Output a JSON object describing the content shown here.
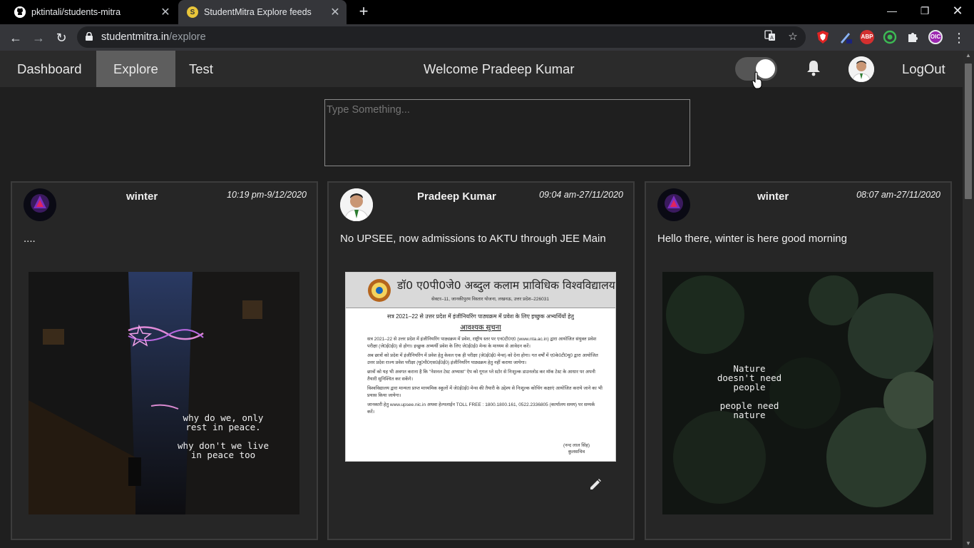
{
  "browser": {
    "tabs": [
      {
        "title": "pktintali/students-mitra",
        "icon": "github-icon",
        "active": false
      },
      {
        "title": "StudentMitra Explore feeds",
        "icon": "studentmitra-favicon",
        "active": true
      }
    ],
    "url_domain": "studentmitra.in",
    "url_path": "/explore",
    "extensions": [
      "brave-shield-icon",
      "pen-extension-icon",
      "adblock-plus-icon",
      "circle-extension-icon",
      "puzzle-extensions-icon",
      "profile-extension-icon"
    ],
    "abp_label": "ABP",
    "profile_badge": "OIC"
  },
  "nav": {
    "links": [
      "Dashboard",
      "Explore",
      "Test"
    ],
    "active": "Explore",
    "welcome": "Welcome Pradeep Kumar",
    "theme_toggle_on": true,
    "logout": "LogOut"
  },
  "composer": {
    "placeholder": "Type Something..."
  },
  "posts": [
    {
      "author": "winter",
      "time": "10:19 pm-9/12/2020",
      "text": "....",
      "image_caption": "why do we, only rest in peace. why don't we live in peace too",
      "image_caption_lines": [
        "why do we, only",
        "rest in peace.",
        "",
        "why don't we live",
        "in peace too"
      ]
    },
    {
      "author": "Pradeep Kumar",
      "time": "09:04 am-27/11/2020",
      "text": "No UPSEE, now admissions to AKTU through JEE Main",
      "image_doc": {
        "heading": "डॉ0 ए0पी0जे0 अब्दुल कलाम प्राविधिक विश्वविद्यालय",
        "subheading": "सेक्टर–11, जानकीपुरम विस्तार योजना, लखनऊ, उत्तर प्रदेश–226031",
        "intro": "सत्र 2021–22 से उत्तर प्रदेश में इंजीनियरिंग पाठ्यक्रम में प्रवेश के लिए इच्छुक अभ्यर्थियों हेतु",
        "notice_title": "आवश्यक सूचना",
        "bullets": [
          "सत्र 2021–22 से उत्तर प्रदेश में इंजीनियरिंग पाठ्यक्रम में प्रवेश, राष्ट्रीय स्तर पर एन0टी0ए0 (www.nta.ac.in) द्वारा आयोजित संयुक्त प्रवेश परीक्षा (जे0ई0ई0) से होगा। इच्छुक अभ्यर्थी प्रवेश के लिए जे0ई0ई0 मेन्स के माध्यम से आवेदन करें।",
          "अब छात्रों को प्रदेश में इंजीनियरिंग में प्रवेश हेतु केवल एक ही परीक्षा (जे0ई0ई0 मेन्स) को देना होगा। गत वर्षों में ए0के0टी0यू0 द्वारा आयोजित उत्तर प्रदेश राज्य प्रवेश परीक्षा (यू0पी0एस0ई0ई0) इंजीनियरिंग पाठ्यक्रम हेतु नहीं कराया जायेगा।",
          "छात्रों को यह भी अवगत कराना है कि \"नेशनल टेस्ट अभ्यास\" ऐप को गूगल प्ले स्टोर से निःशुल्क डाउनलोड कर मॉक टेस्ट के आधार पर अपनी तैयारी सुनिश्चित कर सकेंगे।",
          "विश्वविद्यालय द्वारा मान्यता प्राप्त माध्यमिक स्कूलों में जे0ई0ई0 मेन्स की तैयारी के उद्देश्य से निःशुल्क कोचिंग कक्षाएं आयोजित कराये जाने का भी प्रयास किया जायेगा।",
          "जानकारी हेतु www.upsee.nic.in अथवा हेल्पलाईन TOLL FREE : 1800.1800.161, 0522.2336805 (कार्यालय समय) पर सम्पर्क करें।"
        ],
        "signature_name": "(नन्द लाल सिंह)",
        "signature_title": "कुलसचिव"
      }
    },
    {
      "author": "winter",
      "time": "08:07 am-27/11/2020",
      "text": "Hello there, winter is here good morning",
      "image_caption": "Nature doesn't need people people need nature",
      "image_caption_lines": [
        "Nature",
        "doesn't need",
        "people",
        "",
        "people need",
        "nature"
      ]
    }
  ],
  "colors": {
    "background": "#1f1f1f",
    "card": "#262626",
    "navbar": "#2b2b2b",
    "active_nav": "#5e5e5e"
  }
}
